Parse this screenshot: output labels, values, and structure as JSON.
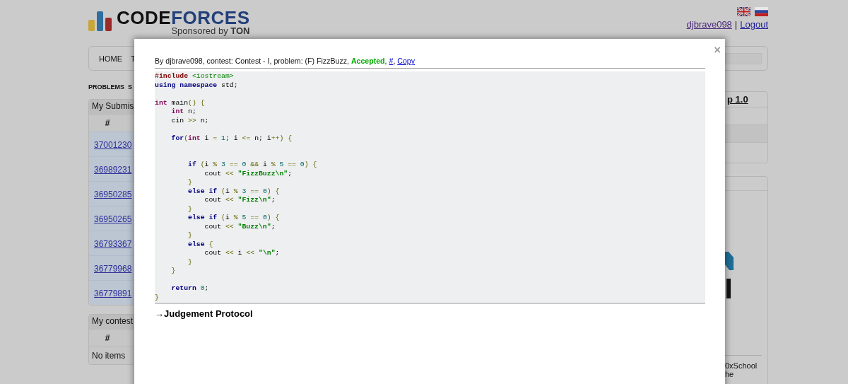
{
  "header": {
    "logo": {
      "parts": [
        "CODE",
        "FORCES"
      ],
      "tagline": "Sponsored by **TON**"
    },
    "user": {
      "name": "djbrave098",
      "separator": "|",
      "logout": "Logout"
    }
  },
  "menu": {
    "items": [
      "HOME",
      "T"
    ]
  },
  "tabs": [
    "PROBLEMS",
    "S"
  ],
  "submissions_panel": {
    "title": "My Submis",
    "column_1": "#",
    "rows": [
      "37001230",
      "36989231",
      "36950285",
      "36950265",
      "36793367",
      "36779968",
      "36779891"
    ]
  },
  "contests_panel": {
    "title": "My contest",
    "column_1": "#",
    "empty": "No items"
  },
  "sidebar": {
    "box_title": "p 1.0",
    "footer_lines": [
      "0xSchool",
      "he"
    ]
  },
  "modal": {
    "close": "×",
    "info": [
      {
        "kind": "text",
        "text": "By djbrave098, contest: Contest - I, problem: (F) FizzBuzz, "
      },
      {
        "kind": "verdict",
        "text": "Accepted"
      },
      {
        "kind": "text",
        "text": ", "
      },
      {
        "kind": "link",
        "text": "#"
      },
      {
        "kind": "text",
        "text": ", "
      },
      {
        "kind": "link",
        "text": "Copy"
      }
    ],
    "code": [
      {
        "kind": "pp",
        "text": "#include "
      },
      {
        "kind": "inc",
        "text": "<iostream>"
      },
      {
        "kind": "kw",
        "text": "\nusing namespace"
      },
      {
        "kind": "pl",
        "text": " std;\n\n"
      },
      {
        "kind": "ty",
        "text": "int"
      },
      {
        "kind": "pl",
        "text": " main"
      },
      {
        "kind": "op",
        "text": "() {"
      },
      {
        "kind": "ty",
        "text": "\n    int"
      },
      {
        "kind": "pl",
        "text": " n;\n    cin "
      },
      {
        "kind": "op",
        "text": ">>"
      },
      {
        "kind": "pl",
        "text": " n;\n\n    "
      },
      {
        "kind": "kw",
        "text": "for"
      },
      {
        "kind": "op",
        "text": "("
      },
      {
        "kind": "ty",
        "text": "int"
      },
      {
        "kind": "pl",
        "text": " i "
      },
      {
        "kind": "op",
        "text": "="
      },
      {
        "kind": "num",
        "text": " 1"
      },
      {
        "kind": "pl",
        "text": "; i "
      },
      {
        "kind": "op",
        "text": "<="
      },
      {
        "kind": "pl",
        "text": " n; i"
      },
      {
        "kind": "op",
        "text": "++) {"
      },
      {
        "kind": "kw",
        "text": "\n\n\n        if"
      },
      {
        "kind": "op",
        "text": " ("
      },
      {
        "kind": "pl",
        "text": "i "
      },
      {
        "kind": "op",
        "text": "%"
      },
      {
        "kind": "num",
        "text": " 3 "
      },
      {
        "kind": "op",
        "text": "=="
      },
      {
        "kind": "num",
        "text": " 0 "
      },
      {
        "kind": "op",
        "text": "&&"
      },
      {
        "kind": "pl",
        "text": " i "
      },
      {
        "kind": "op",
        "text": "%"
      },
      {
        "kind": "num",
        "text": " 5 "
      },
      {
        "kind": "op",
        "text": "=="
      },
      {
        "kind": "num",
        "text": " 0"
      },
      {
        "kind": "op",
        "text": ") {"
      },
      {
        "kind": "pl",
        "text": "\n            cout "
      },
      {
        "kind": "op",
        "text": "<<"
      },
      {
        "kind": "str",
        "text": " \"FizzBuzz\\n\""
      },
      {
        "kind": "pl",
        "text": ";"
      },
      {
        "kind": "op",
        "text": "\n        }"
      },
      {
        "kind": "kw",
        "text": "\n        else if"
      },
      {
        "kind": "op",
        "text": " ("
      },
      {
        "kind": "pl",
        "text": "i "
      },
      {
        "kind": "op",
        "text": "%"
      },
      {
        "kind": "num",
        "text": " 3 "
      },
      {
        "kind": "op",
        "text": "=="
      },
      {
        "kind": "num",
        "text": " 0"
      },
      {
        "kind": "op",
        "text": ") {"
      },
      {
        "kind": "pl",
        "text": "\n            cout "
      },
      {
        "kind": "op",
        "text": "<<"
      },
      {
        "kind": "str",
        "text": " \"Fizz\\n\""
      },
      {
        "kind": "pl",
        "text": ";"
      },
      {
        "kind": "op",
        "text": "\n        }"
      },
      {
        "kind": "kw",
        "text": "\n        else if"
      },
      {
        "kind": "op",
        "text": " ("
      },
      {
        "kind": "pl",
        "text": "i "
      },
      {
        "kind": "op",
        "text": "%"
      },
      {
        "kind": "num",
        "text": " 5 "
      },
      {
        "kind": "op",
        "text": "=="
      },
      {
        "kind": "num",
        "text": " 0"
      },
      {
        "kind": "op",
        "text": ") {"
      },
      {
        "kind": "pl",
        "text": "\n            cout "
      },
      {
        "kind": "op",
        "text": "<<"
      },
      {
        "kind": "str",
        "text": " \"Buzz\\n\""
      },
      {
        "kind": "pl",
        "text": ";"
      },
      {
        "kind": "op",
        "text": "\n        }"
      },
      {
        "kind": "kw",
        "text": "\n        else"
      },
      {
        "kind": "op",
        "text": " {"
      },
      {
        "kind": "pl",
        "text": "\n            cout "
      },
      {
        "kind": "op",
        "text": "<<"
      },
      {
        "kind": "pl",
        "text": " i "
      },
      {
        "kind": "op",
        "text": "<<"
      },
      {
        "kind": "str",
        "text": " \"\\n\""
      },
      {
        "kind": "pl",
        "text": ";"
      },
      {
        "kind": "op",
        "text": "\n        }\n    }"
      },
      {
        "kind": "kw",
        "text": "\n\n    return"
      },
      {
        "kind": "num",
        "text": " 0"
      },
      {
        "kind": "pl",
        "text": ";"
      },
      {
        "kind": "op",
        "text": "\n}"
      }
    ],
    "protocol": "→Judgement Protocol"
  }
}
